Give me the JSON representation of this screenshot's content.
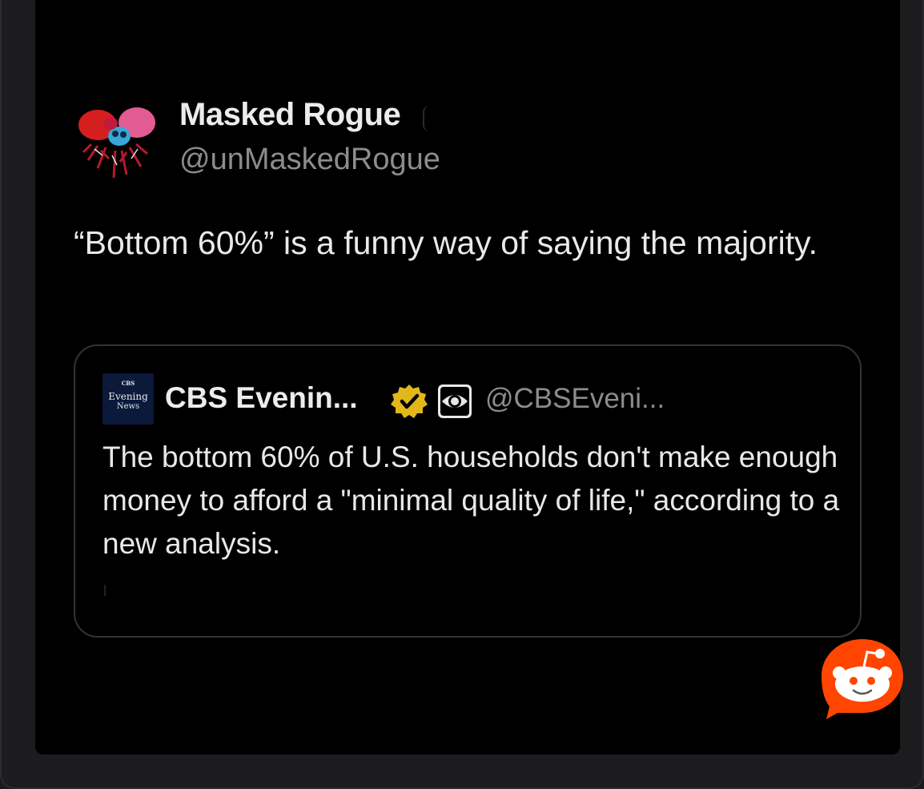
{
  "tweet": {
    "author": {
      "display_name": "Masked Rogue",
      "handle": "@unMaskedRogue",
      "avatar_icon": "masked-rogue-avatar"
    },
    "text": "“Bottom 60%” is a funny way of saying the majority."
  },
  "quoted_tweet": {
    "logo_lines": [
      "CBS",
      "Evening",
      "News"
    ],
    "display_name": "CBS Evenin...",
    "handle": "@CBSEveni...",
    "verified_icon": "verified-gold-badge-icon",
    "affiliate_icon": "cbs-eye-icon",
    "text": "The bottom 60% of U.S. households don't make enough money to afford a \"minimal quality of life,\" according to a new analysis."
  },
  "watermark": {
    "icon": "reddit-icon"
  },
  "colors": {
    "background": "#000000",
    "frame": "#1c1c1f",
    "primary_text": "#ececec",
    "secondary_text": "#8c8c8c",
    "quote_border": "#333336",
    "verified_gold": "#e2b719",
    "reddit_orange": "#ff4500"
  }
}
